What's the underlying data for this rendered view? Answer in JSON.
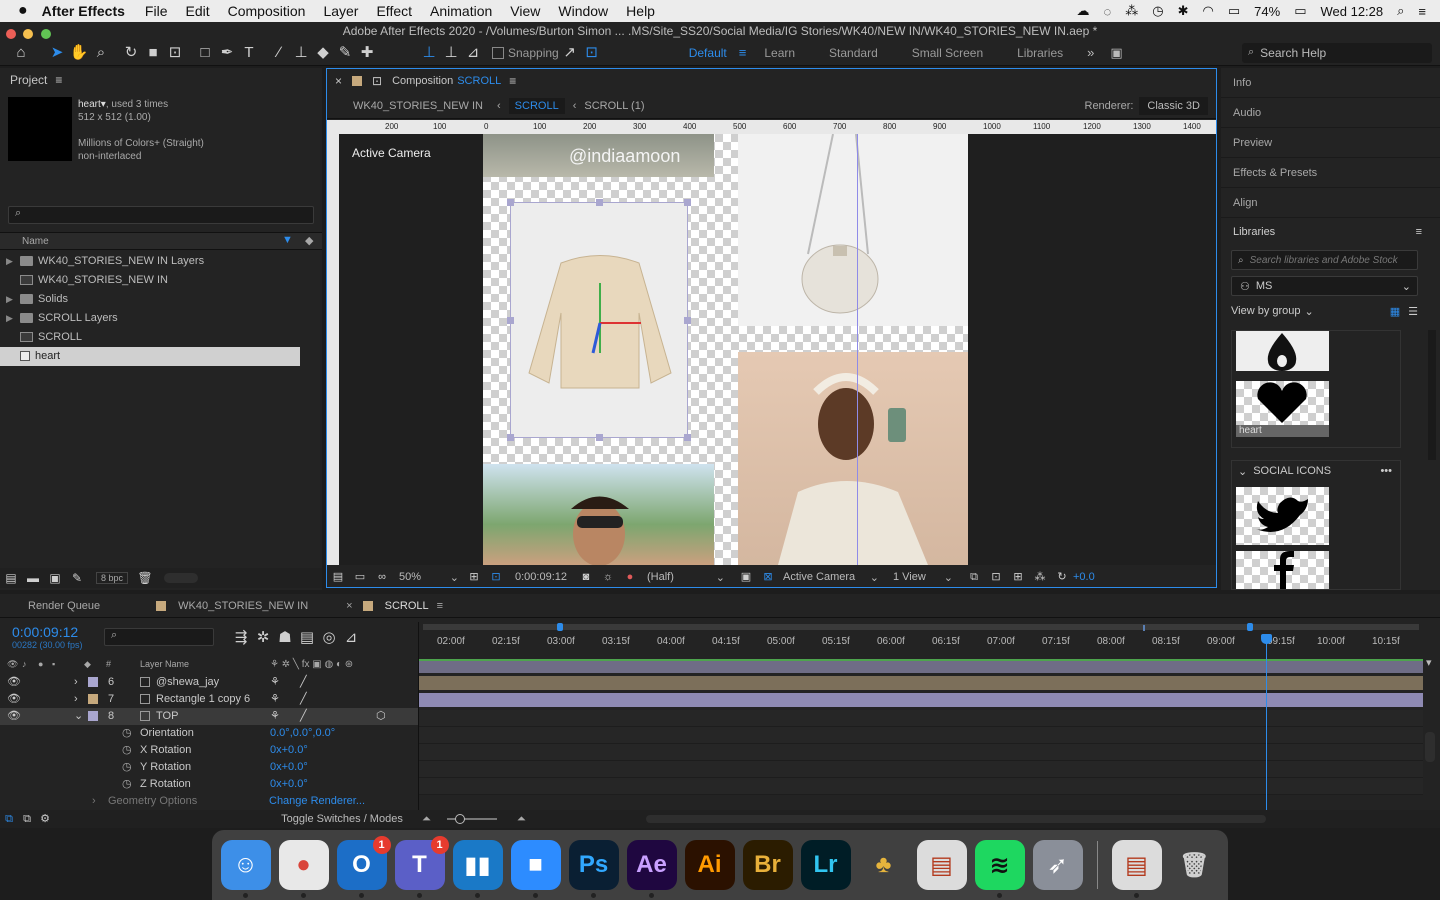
{
  "menubar": {
    "app": "After Effects",
    "items": [
      "File",
      "Edit",
      "Composition",
      "Layer",
      "Effect",
      "Animation",
      "View",
      "Window",
      "Help"
    ],
    "battery": "74%",
    "clock": "Wed 12:28"
  },
  "window": {
    "title": "Adobe After Effects 2020 - /Volumes/Burton Simon  ... .MS/Site_SS20/Social Media/IG Stories/WK40/NEW IN/WK40_STORIES_NEW IN.aep *"
  },
  "toolbar": {
    "snapping_label": "Snapping",
    "workspaces": [
      "Default",
      "Learn",
      "Standard",
      "Small Screen",
      "Libraries"
    ],
    "search_placeholder": "Search Help"
  },
  "project": {
    "title": "Project",
    "item_name": "heart",
    "used": ", used 3 times",
    "size": "512 x 512 (1.00)",
    "colors": "Millions of Colors+ (Straight)",
    "interlace": "non-interlaced",
    "col_name": "Name",
    "items": [
      {
        "label": "WK40_STORIES_NEW IN Layers",
        "type": "folder"
      },
      {
        "label": "WK40_STORIES_NEW IN",
        "type": "comp"
      },
      {
        "label": "Solids",
        "type": "folder"
      },
      {
        "label": "SCROLL Layers",
        "type": "folder"
      },
      {
        "label": "SCROLL",
        "type": "comp"
      },
      {
        "label": "heart",
        "type": "file"
      }
    ],
    "bpc": "8 bpc"
  },
  "composition": {
    "header_label": "Composition",
    "header_name": "SCROLL",
    "breadcrumbs": [
      "WK40_STORIES_NEW IN",
      "SCROLL",
      "SCROLL (1)"
    ],
    "renderer_label": "Renderer:",
    "renderer_value": "Classic 3D",
    "camera_label": "Active Camera",
    "ruler_ticks": [
      "200",
      "100",
      "0",
      "100",
      "200",
      "300",
      "400",
      "500",
      "600",
      "700",
      "800",
      "900",
      "1000",
      "1100",
      "1200",
      "1300",
      "1400"
    ],
    "watermark": "@indiaamoon",
    "zoom": "50%",
    "timecode": "0:00:09:12",
    "resolution": "(Half)",
    "view_camera": "Active Camera",
    "views": "1 View",
    "exposure": "+0.0"
  },
  "right_panel": {
    "items": [
      "Info",
      "Audio",
      "Preview",
      "Effects & Presets",
      "Align"
    ],
    "libraries_title": "Libraries",
    "lib_search_placeholder": "Search libraries and Adobe Stock",
    "lib_name": "MS",
    "view_by": "View by group",
    "heart_label": "heart",
    "social_icons": "SOCIAL ICONS"
  },
  "timeline": {
    "tabs": [
      "Render Queue",
      "WK40_STORIES_NEW IN",
      "SCROLL"
    ],
    "timecode": "0:00:09:12",
    "frame_info": "00282 (30.00 fps)",
    "col_layer_name": "Layer Name",
    "col_num": "#",
    "ruler": [
      "02:00f",
      "02:15f",
      "03:00f",
      "03:15f",
      "04:00f",
      "04:15f",
      "05:00f",
      "05:15f",
      "06:00f",
      "06:15f",
      "07:00f",
      "07:15f",
      "08:00f",
      "08:15f",
      "09:00f",
      "09:15f",
      "10:00f",
      "10:15f"
    ],
    "layers": [
      {
        "num": "6",
        "name": "@shewa_jay",
        "color": "#a9a6cf"
      },
      {
        "num": "7",
        "name": "Rectangle 1 copy 6",
        "color": "#c6a97d"
      },
      {
        "num": "8",
        "name": "TOP",
        "color": "#a9a6cf"
      }
    ],
    "props": [
      {
        "name": "Orientation",
        "value": "0.0°,0.0°,0.0°"
      },
      {
        "name": "X Rotation",
        "value": "0x+0.0°"
      },
      {
        "name": "Y Rotation",
        "value": "0x+0.0°"
      },
      {
        "name": "Z Rotation",
        "value": "0x+0.0°"
      }
    ],
    "geometry": "Geometry Options",
    "change_renderer": "Change Renderer...",
    "toggle": "Toggle Switches / Modes"
  },
  "dock": {
    "apps": [
      {
        "name": "Finder",
        "glyph": "☺",
        "bg": "#3d8fe8",
        "fg": "#ffffff",
        "badge": ""
      },
      {
        "name": "Chrome",
        "glyph": "●",
        "bg": "#e8e8e8",
        "fg": "#d9443a",
        "badge": ""
      },
      {
        "name": "Outlook",
        "glyph": "O",
        "bg": "#1c6ec7",
        "fg": "#ffffff",
        "badge": "1"
      },
      {
        "name": "Teams",
        "glyph": "T",
        "bg": "#5b5fc7",
        "fg": "#ffffff",
        "badge": "1"
      },
      {
        "name": "Trello",
        "glyph": "▮▮",
        "bg": "#1a79c7",
        "fg": "#ffffff",
        "badge": ""
      },
      {
        "name": "Zoom",
        "glyph": "■",
        "bg": "#2d8cff",
        "fg": "#ffffff",
        "badge": ""
      },
      {
        "name": "Photoshop",
        "glyph": "Ps",
        "bg": "#0a1f33",
        "fg": "#31a8ff",
        "badge": ""
      },
      {
        "name": "AfterEffects",
        "glyph": "Ae",
        "bg": "#1f0740",
        "fg": "#c9a0ff",
        "badge": ""
      },
      {
        "name": "Illustrator",
        "glyph": "Ai",
        "bg": "#2b1100",
        "fg": "#ff9a00",
        "badge": ""
      },
      {
        "name": "Bridge",
        "glyph": "Br",
        "bg": "#2b1c00",
        "fg": "#e8b03a",
        "badge": ""
      },
      {
        "name": "Lightroom",
        "glyph": "Lr",
        "bg": "#001d26",
        "fg": "#31c5f0",
        "badge": ""
      },
      {
        "name": "Pineapple",
        "glyph": "♣",
        "bg": "transparent",
        "fg": "#e6b43c",
        "badge": ""
      },
      {
        "name": "Printer",
        "glyph": "▤",
        "bg": "#dcdcdc",
        "fg": "#b33a1e",
        "badge": ""
      },
      {
        "name": "Spotify",
        "glyph": "≋",
        "bg": "#1ed760",
        "fg": "#111111",
        "badge": ""
      },
      {
        "name": "Launchpad",
        "glyph": "➶",
        "bg": "#8a8f99",
        "fg": "#ffffff",
        "badge": ""
      },
      {
        "name": "Printer2",
        "glyph": "▤",
        "bg": "#dcdcdc",
        "fg": "#b33a1e",
        "badge": ""
      },
      {
        "name": "Trash",
        "glyph": "🗑",
        "bg": "transparent",
        "fg": "#d0d0d0",
        "badge": ""
      }
    ]
  }
}
